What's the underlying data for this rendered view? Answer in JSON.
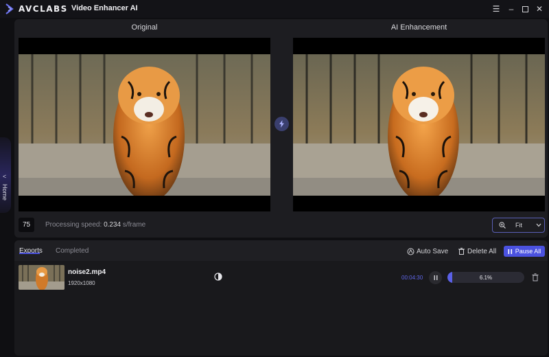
{
  "app": {
    "brand": "AVCLABS",
    "name": "Video Enhancer AI"
  },
  "window_controls": [
    "menu-icon",
    "minimize-icon",
    "maximize-icon",
    "close-icon"
  ],
  "sidebar": {
    "home_label": "Home"
  },
  "preview": {
    "left_title": "Original",
    "right_title": "AI Enhancement",
    "frame_value": "75",
    "speed_label": "Processing speed:",
    "speed_value": "0.234",
    "speed_unit": "s/frame",
    "zoom_value": "Fit"
  },
  "exports": {
    "tabs": [
      {
        "label": "Exports",
        "active": true
      },
      {
        "label": "Completed",
        "active": false
      }
    ],
    "auto_save_label": "Auto Save",
    "delete_all_label": "Delete All",
    "pause_all_label": "Pause All",
    "items": [
      {
        "file_name": "noise2.mp4",
        "resolution": "1920x1080",
        "elapsed": "00:04:30",
        "progress": 0.061,
        "progress_label": "6.1%"
      }
    ]
  },
  "colors": {
    "accent": "#4b52e0",
    "background": "#0f0f12",
    "panel": "#1d1d21"
  }
}
